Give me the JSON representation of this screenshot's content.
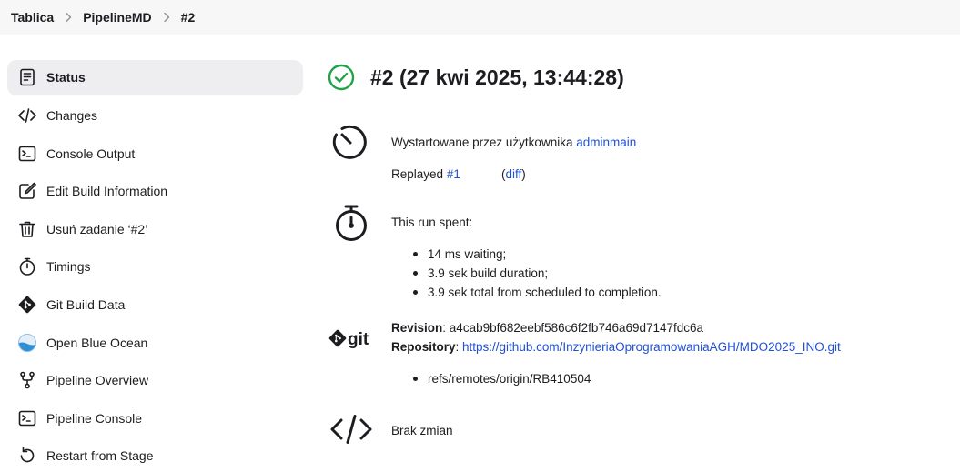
{
  "breadcrumb": {
    "items": [
      "Tablica",
      "PipelineMD",
      "#2"
    ]
  },
  "sidebar": {
    "items": [
      {
        "label": "Status",
        "icon": "document-icon",
        "active": true
      },
      {
        "label": "Changes",
        "icon": "code-icon"
      },
      {
        "label": "Console Output",
        "icon": "terminal-icon"
      },
      {
        "label": "Edit Build Information",
        "icon": "edit-icon"
      },
      {
        "label": "Usuń zadanie ‘#2’",
        "icon": "trash-icon"
      },
      {
        "label": "Timings",
        "icon": "stopwatch-icon"
      },
      {
        "label": "Git Build Data",
        "icon": "git-icon"
      },
      {
        "label": "Open Blue Ocean",
        "icon": "blue-ocean-icon"
      },
      {
        "label": "Pipeline Overview",
        "icon": "pipeline-icon"
      },
      {
        "label": "Pipeline Console",
        "icon": "terminal-icon"
      },
      {
        "label": "Restart from Stage",
        "icon": "restart-icon"
      }
    ]
  },
  "build": {
    "title": "#2 (27 kwi 2025, 13:44:28)",
    "status": "success",
    "status_color": "#1ea446"
  },
  "cause": {
    "started_by_prefix": "Wystartowane przez użytkownika",
    "user": "adminmain",
    "replayed_prefix": "Replayed",
    "replayed_link": "#1",
    "diff_open": "(",
    "diff_link": "diff",
    "diff_close": ")"
  },
  "timing": {
    "heading": "This run spent:",
    "items": [
      "14 ms waiting;",
      "3.9 sek build duration;",
      "3.9 sek total from scheduled to completion."
    ]
  },
  "git": {
    "logo_text": "git",
    "revision_label": "Revision",
    "revision_value": "a4cab9bf682eebf586c6f2fb746a69d7147fdc6a",
    "repository_label": "Repository",
    "repository_url": "https://github.com/InzynieriaOprogramowaniaAGH/MDO2025_INO.git",
    "branches": [
      "refs/remotes/origin/RB410504"
    ]
  },
  "changes": {
    "text": "Brak zmian"
  },
  "colors": {
    "link": "#2050d6",
    "active_bg": "#eeeef1",
    "breadcrumb_bg": "#f7f7f8"
  }
}
